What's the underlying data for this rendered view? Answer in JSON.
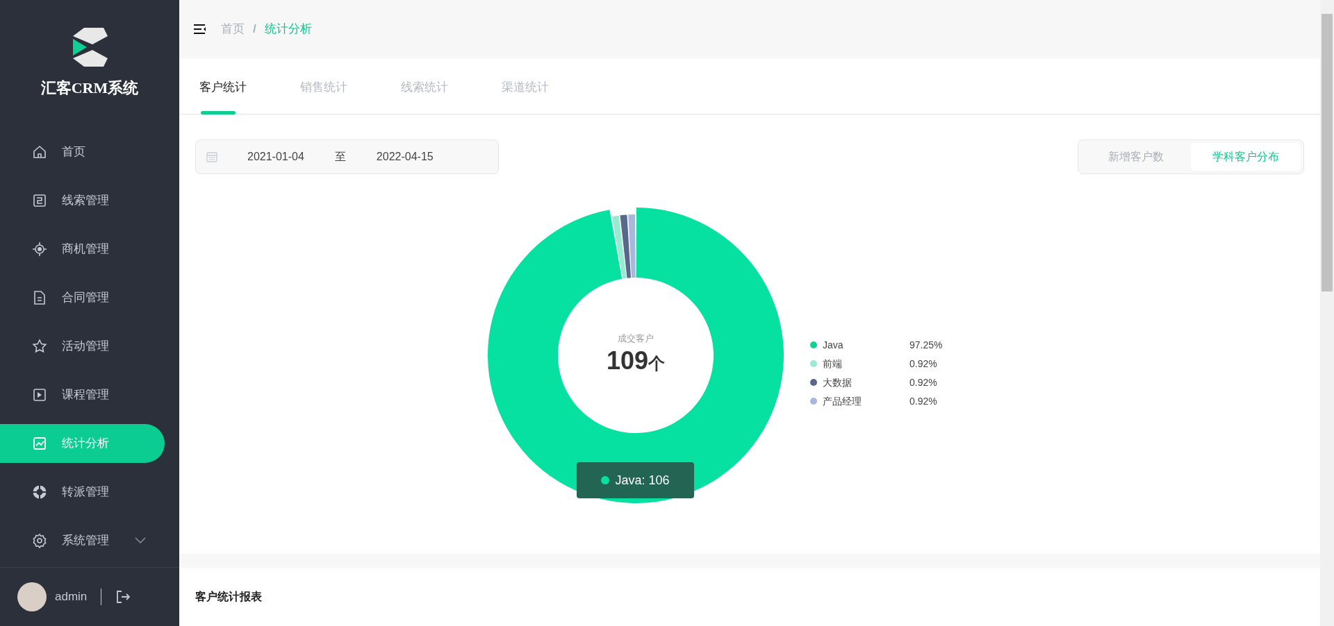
{
  "sidebar": {
    "title": "汇客CRM系统",
    "items": [
      {
        "label": "首页",
        "selected": false
      },
      {
        "label": "线索管理",
        "selected": false
      },
      {
        "label": "商机管理",
        "selected": false
      },
      {
        "label": "合同管理",
        "selected": false
      },
      {
        "label": "活动管理",
        "selected": false
      },
      {
        "label": "课程管理",
        "selected": false
      },
      {
        "label": "统计分析",
        "selected": true
      },
      {
        "label": "转派管理",
        "selected": false
      },
      {
        "label": "系统管理",
        "selected": false,
        "expanded": false
      }
    ],
    "user": {
      "name": "admin"
    }
  },
  "breadcrumb": {
    "separator": "/",
    "items": [
      {
        "label": "首页",
        "selected": false
      },
      {
        "label": "统计分析",
        "selected": true
      }
    ]
  },
  "tabs": [
    {
      "label": "客户统计",
      "selected": true
    },
    {
      "label": "销售统计",
      "selected": false
    },
    {
      "label": "线索统计",
      "selected": false
    },
    {
      "label": "渠道统计",
      "selected": false
    }
  ],
  "date_range": {
    "start": "2021-01-04",
    "separator": "至",
    "end": "2022-04-15"
  },
  "toggle": [
    {
      "label": "新增客户数",
      "selected": false
    },
    {
      "label": "学科客户分布",
      "selected": true
    }
  ],
  "donut": {
    "center_label": "成交客户",
    "center_value": "109",
    "center_unit": "个",
    "tooltip": "Java: 106",
    "chart_data": {
      "type": "donut",
      "categories": [
        "Java",
        "前端",
        "大数据",
        "产品经理"
      ],
      "series": [
        {
          "values": [
            97.25,
            0.92,
            0.92,
            0.92
          ]
        }
      ],
      "colors": [
        "#06e0a1",
        "#98ead2",
        "#58678a",
        "#a7b7de"
      ]
    },
    "legend": [
      {
        "value": "97.25%",
        "color": "#13cf95"
      },
      {
        "value": "0.92%",
        "color": "#98ead2"
      },
      {
        "value": "0.92%",
        "color": "#58678a"
      },
      {
        "value": "0.92%",
        "color": "#a7b7de"
      }
    ]
  },
  "report": {
    "title": "客户统计报表"
  }
}
